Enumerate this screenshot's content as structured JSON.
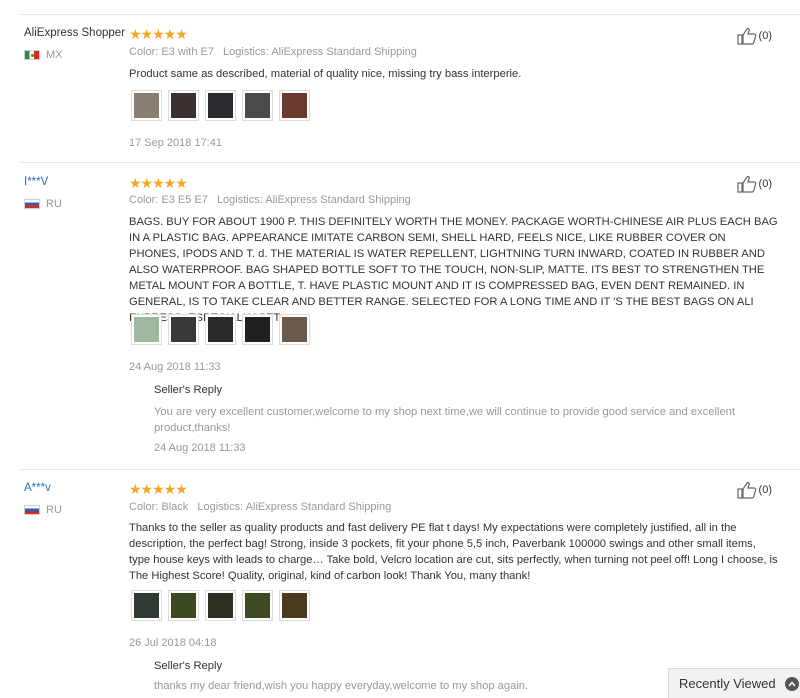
{
  "reviews": [
    {
      "user": "AliExpress Shopper",
      "country": "MX",
      "stars": "★★★★★",
      "color": "Color: E3 with E7",
      "logistics": "Logistics: AliExpress Standard Shipping",
      "text": "Product same as described, material of quality nice, missing try bass interperie.",
      "date": "17 Sep 2018 17:41",
      "useful_count": "(0)",
      "thumb_colors": [
        "#8a7e72",
        "#3a3230",
        "#2a2a2e",
        "#4a4a4a",
        "#6a3a2e"
      ]
    },
    {
      "user": "I***V",
      "country": "RU",
      "stars": "★★★★★",
      "color": "Color: E3 E5 E7",
      "logistics": "Logistics: AliExpress Standard Shipping",
      "text": "BAGS. BUY FOR ABOUT 1900 P. THIS DEFINITELY WORTH THE MONEY. PACKAGE WORTH-CHINESE AIR PLUS EACH BAG IN A PLASTIC BAG. APPEARANCE IMITATE CARBON SEMI, SHELL HARD, FEELS NICE, LIKE RUBBER COVER ON PHONES, IPODS AND T. d. THE MATERIAL IS WATER REPELLENT, LIGHTNING TURN INWARD, COATED IN RUBBER AND ALSO WATERPROOF. BAG SHAPED BOTTLE SOFT TO THE TOUCH, NON-SLIP, MATTE. ITS BEST TO STRENGTHEN THE METAL MOUNT FOR A BOTTLE, T. HAVE PLASTIC MOUNT AND IT IS COMPRESSED BAG, EVEN DENT REMAINED. IN GENERAL, IS TO TAKE CLEAR AND BETTER RANGE. SELECTED FOR A LONG TIME AND IT 'S THE BEST BAGS ON ALI EXPRESS, ESPECIALLY SET.",
      "date": "24 Aug 2018 11:33",
      "useful_count": "(0)",
      "thumb_colors": [
        "#9fb8a0",
        "#3a3836",
        "#2a2828",
        "#202020",
        "#6a5a4e"
      ],
      "seller_reply": {
        "title": "Seller's Reply",
        "text": "You are very excellent customer,welcome to my shop next time,we will continue to provide good service and excellent product,thanks!",
        "date": "24 Aug 2018 11:33"
      }
    },
    {
      "user": "A***v",
      "country": "RU",
      "stars": "★★★★★",
      "color": "Color: Black",
      "logistics": "Logistics: AliExpress Standard Shipping",
      "text": "Thanks to the seller as quality products and fast delivery PE flat t days! My expectations were completely justified, all in the description, the perfect bag! Strong, inside 3 pockets, fit your phone 5,5 inch, Paverbank 100000 swings and other small items, type house keys with leads to charge… Take bold, Velcro location are cut, sits perfectly, when turning not peel off! Long I choose, is The Highest Score! Quality, original, kind of carbon look! Thank You, many thank!",
      "date": "26 Jul 2018 04:18",
      "useful_count": "(0)",
      "thumb_colors": [
        "#2e3a32",
        "#3a4a1e",
        "#2e2e22",
        "#3e4a20",
        "#4a3a1e"
      ],
      "seller_reply": {
        "title": "Seller's Reply",
        "text": "thanks my dear friend,wish you happy everyday,welcome to my shop again.",
        "date": ""
      }
    }
  ],
  "recently_viewed": {
    "label": "Recently Viewed"
  },
  "colors": {
    "star": "#f5a623",
    "link": "#2a6ebb",
    "muted": "#999999"
  }
}
